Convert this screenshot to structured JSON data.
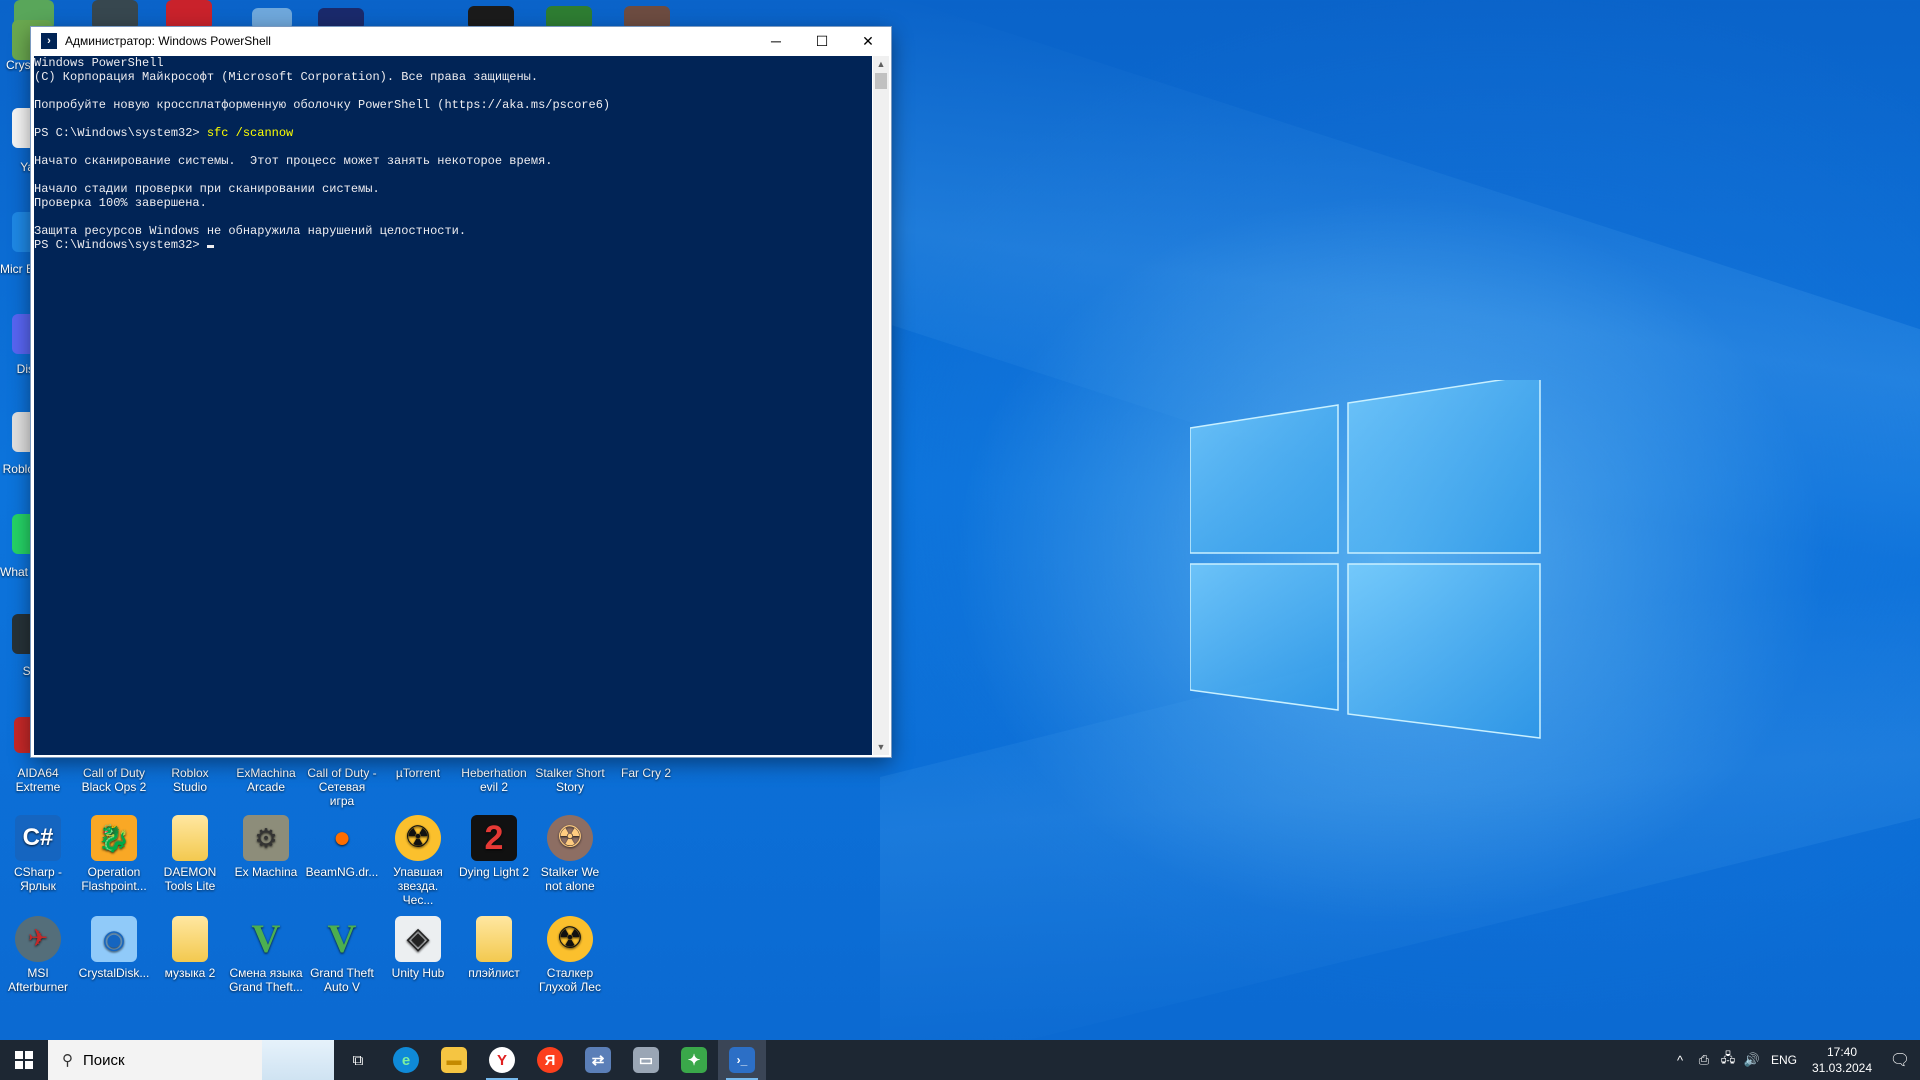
{
  "desktop": {
    "left_edge_labels": [
      "Cryst",
      "Ya",
      "Micr Ed",
      "Dis",
      "Roblo",
      "What Яр",
      "St"
    ],
    "icons_row1": [
      {
        "label": "AIDA64 Extreme",
        "icon": "aida64-icon"
      },
      {
        "label": "Call of Duty Black Ops 2",
        "icon": "cod-icon"
      },
      {
        "label": "Roblox Studio",
        "icon": "roblox-icon"
      },
      {
        "label": "ExMachina Arcade",
        "icon": "exmachina-icon"
      },
      {
        "label": "Call of Duty - Сетевая игра",
        "icon": "cod-mp-icon"
      },
      {
        "label": "µTorrent",
        "icon": "utorrent-icon"
      },
      {
        "label": "Heberhation evil 2",
        "icon": "game-icon"
      },
      {
        "label": "Stalker Short Story",
        "icon": "stalker-icon"
      },
      {
        "label": "Far Cry 2",
        "icon": "farcry-icon"
      }
    ],
    "icons_row2": [
      {
        "label": "CSharp - Ярлык",
        "icon": "csharp-icon",
        "glyph": "C#"
      },
      {
        "label": "Operation Flashpoint...",
        "icon": "flashpoint-icon",
        "glyph": "🐉"
      },
      {
        "label": "DAEMON Tools Lite",
        "icon": "folder-icon",
        "glyph": ""
      },
      {
        "label": "Ex Machina",
        "icon": "exmachina-icon",
        "glyph": "⚙"
      },
      {
        "label": "BeamNG.dr...",
        "icon": "beamng-icon",
        "glyph": "●"
      },
      {
        "label": "Упавшая звезда. Чес...",
        "icon": "radiation-icon",
        "glyph": "☢"
      },
      {
        "label": "Dying Light 2",
        "icon": "dyinglight-icon",
        "glyph": "2"
      },
      {
        "label": "Stalker We not alone",
        "icon": "stalker-icon",
        "glyph": "☢"
      }
    ],
    "icons_row3": [
      {
        "label": "MSI Afterburner",
        "icon": "msi-afterburner-icon",
        "glyph": "✈"
      },
      {
        "label": "CrystalDisk...",
        "icon": "crystaldisk-icon",
        "glyph": "◉"
      },
      {
        "label": "музыка 2",
        "icon": "folder-icon",
        "glyph": ""
      },
      {
        "label": "Смена языка Grand Theft...",
        "icon": "gta-icon",
        "glyph": "V"
      },
      {
        "label": "Grand Theft Auto V",
        "icon": "gta-icon",
        "glyph": "V"
      },
      {
        "label": "Unity Hub",
        "icon": "unity-icon",
        "glyph": "◈"
      },
      {
        "label": "плэйлист",
        "icon": "folder-icon",
        "glyph": ""
      },
      {
        "label": "Сталкер Глухой Лес",
        "icon": "radiation-icon",
        "glyph": "☢"
      }
    ]
  },
  "window": {
    "title": "Администратор: Windows PowerShell",
    "minimize": "─",
    "maximize": "☐",
    "close": "✕",
    "lines": {
      "l1": "Windows PowerShell",
      "l2": "(C) Корпорация Майкрософт (Microsoft Corporation). Все права защищены.",
      "l3": "Попробуйте новую кроссплатформенную оболочку PowerShell (https://aka.ms/pscore6)",
      "prompt1": "PS C:\\Windows\\system32> ",
      "cmd1": "sfc /scannow",
      "l5": "Начато сканирование системы.  Этот процесс может занять некоторое время.",
      "l6": "Начало стадии проверки при сканировании системы.",
      "l7": "Проверка 100% завершена.",
      "l8": "Защита ресурсов Windows не обнаружила нарушений целостности.",
      "prompt2": "PS C:\\Windows\\system32> "
    }
  },
  "taskbar": {
    "search_placeholder": "Поиск",
    "apps": [
      {
        "name": "task-view-icon",
        "glyph": "⧉",
        "bg": "transparent",
        "fg": "#ffffff"
      },
      {
        "name": "edge-icon",
        "glyph": "e",
        "bg": "#0f8ad8",
        "fg": "#7df0a0"
      },
      {
        "name": "file-explorer-icon",
        "glyph": "▬",
        "bg": "#f5c542",
        "fg": "#c48a00"
      },
      {
        "name": "yandex-browser-icon",
        "glyph": "Y",
        "bg": "#ffffff",
        "fg": "#e02020"
      },
      {
        "name": "yandex-icon",
        "glyph": "Я",
        "bg": "#fc3f1d",
        "fg": "#ffffff"
      },
      {
        "name": "network-app-icon",
        "glyph": "⇄",
        "bg": "#5b7fb8",
        "fg": "#ffffff"
      },
      {
        "name": "pc-app-icon",
        "glyph": "▭",
        "bg": "#9aa6b5",
        "fg": "#ffffff"
      },
      {
        "name": "green-app-icon",
        "glyph": "✦",
        "bg": "#3aa84a",
        "fg": "#ffffff"
      },
      {
        "name": "powershell-icon",
        "glyph": "›_",
        "bg": "#2c6fc6",
        "fg": "#ffffff",
        "active": true
      }
    ],
    "tray": {
      "chevron": "^",
      "lang": "ENG",
      "time": "17:40",
      "date": "31.03.2024"
    }
  }
}
